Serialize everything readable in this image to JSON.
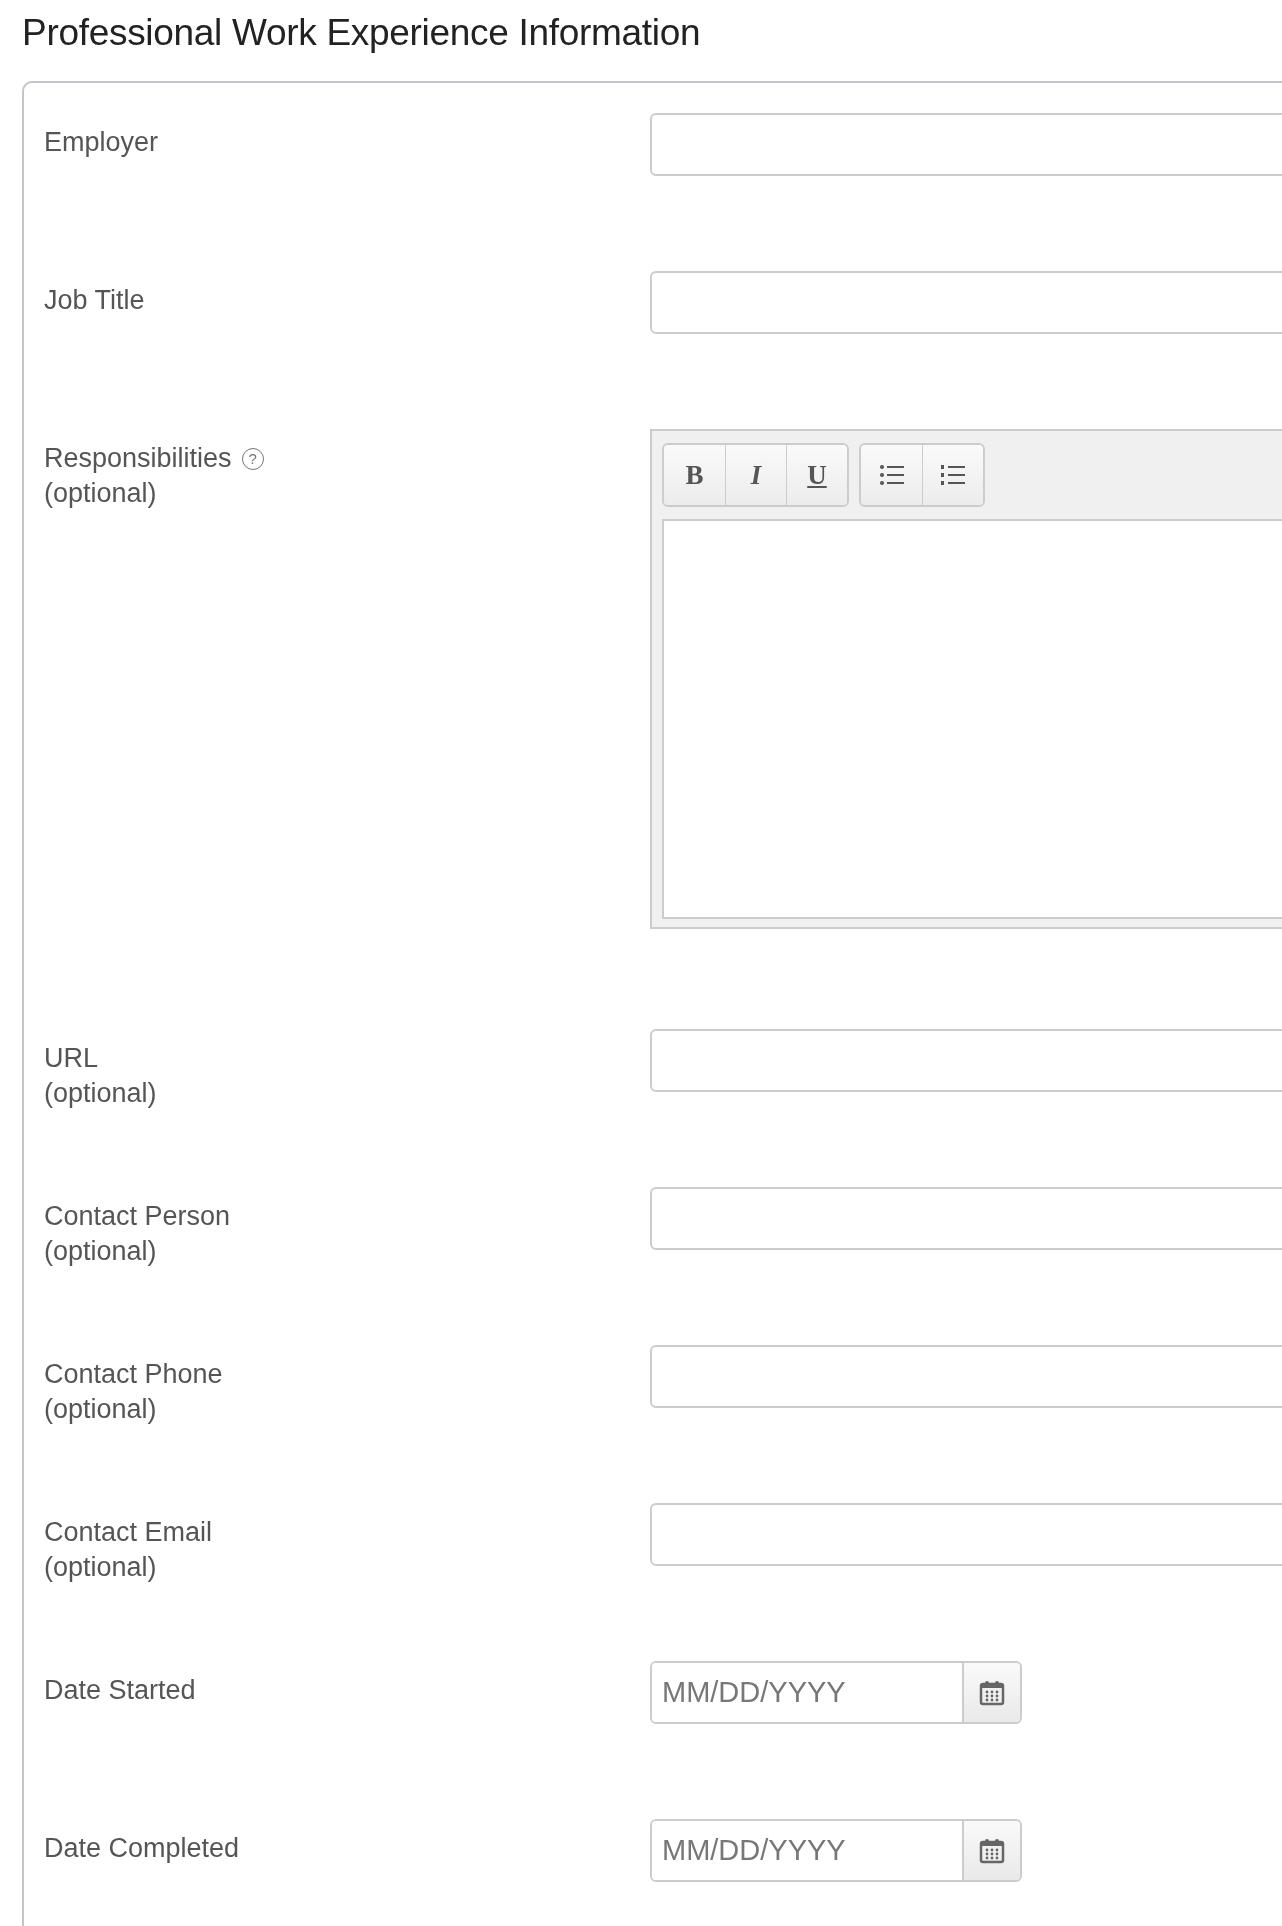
{
  "title": "Professional Work Experience Information",
  "fields": [
    {
      "kind": "text",
      "label": "Employer"
    },
    {
      "kind": "text",
      "label": "Job Title"
    },
    {
      "kind": "rich_text",
      "label": "Responsibilities",
      "help": "?",
      "hint": "(optional)",
      "toolbar": [
        [
          {
            "kind": "bold",
            "label": "B"
          },
          {
            "kind": "italic",
            "label": "I"
          },
          {
            "kind": "underline",
            "label": "U"
          }
        ],
        [
          {
            "kind": "bullet_list"
          },
          {
            "kind": "numbered_list"
          }
        ]
      ]
    },
    {
      "kind": "text",
      "label": "URL",
      "hint": "(optional)"
    },
    {
      "kind": "text",
      "label": "Contact Person",
      "hint": "(optional)"
    },
    {
      "kind": "text",
      "label": "Contact Phone",
      "hint": "(optional)"
    },
    {
      "kind": "text",
      "label": "Contact Email",
      "hint": "(optional)"
    },
    {
      "kind": "date",
      "label": "Date Started",
      "placeholder": "MM/DD/YYYY"
    },
    {
      "kind": "date",
      "label": "Date Completed",
      "placeholder": "MM/DD/YYYY"
    }
  ]
}
